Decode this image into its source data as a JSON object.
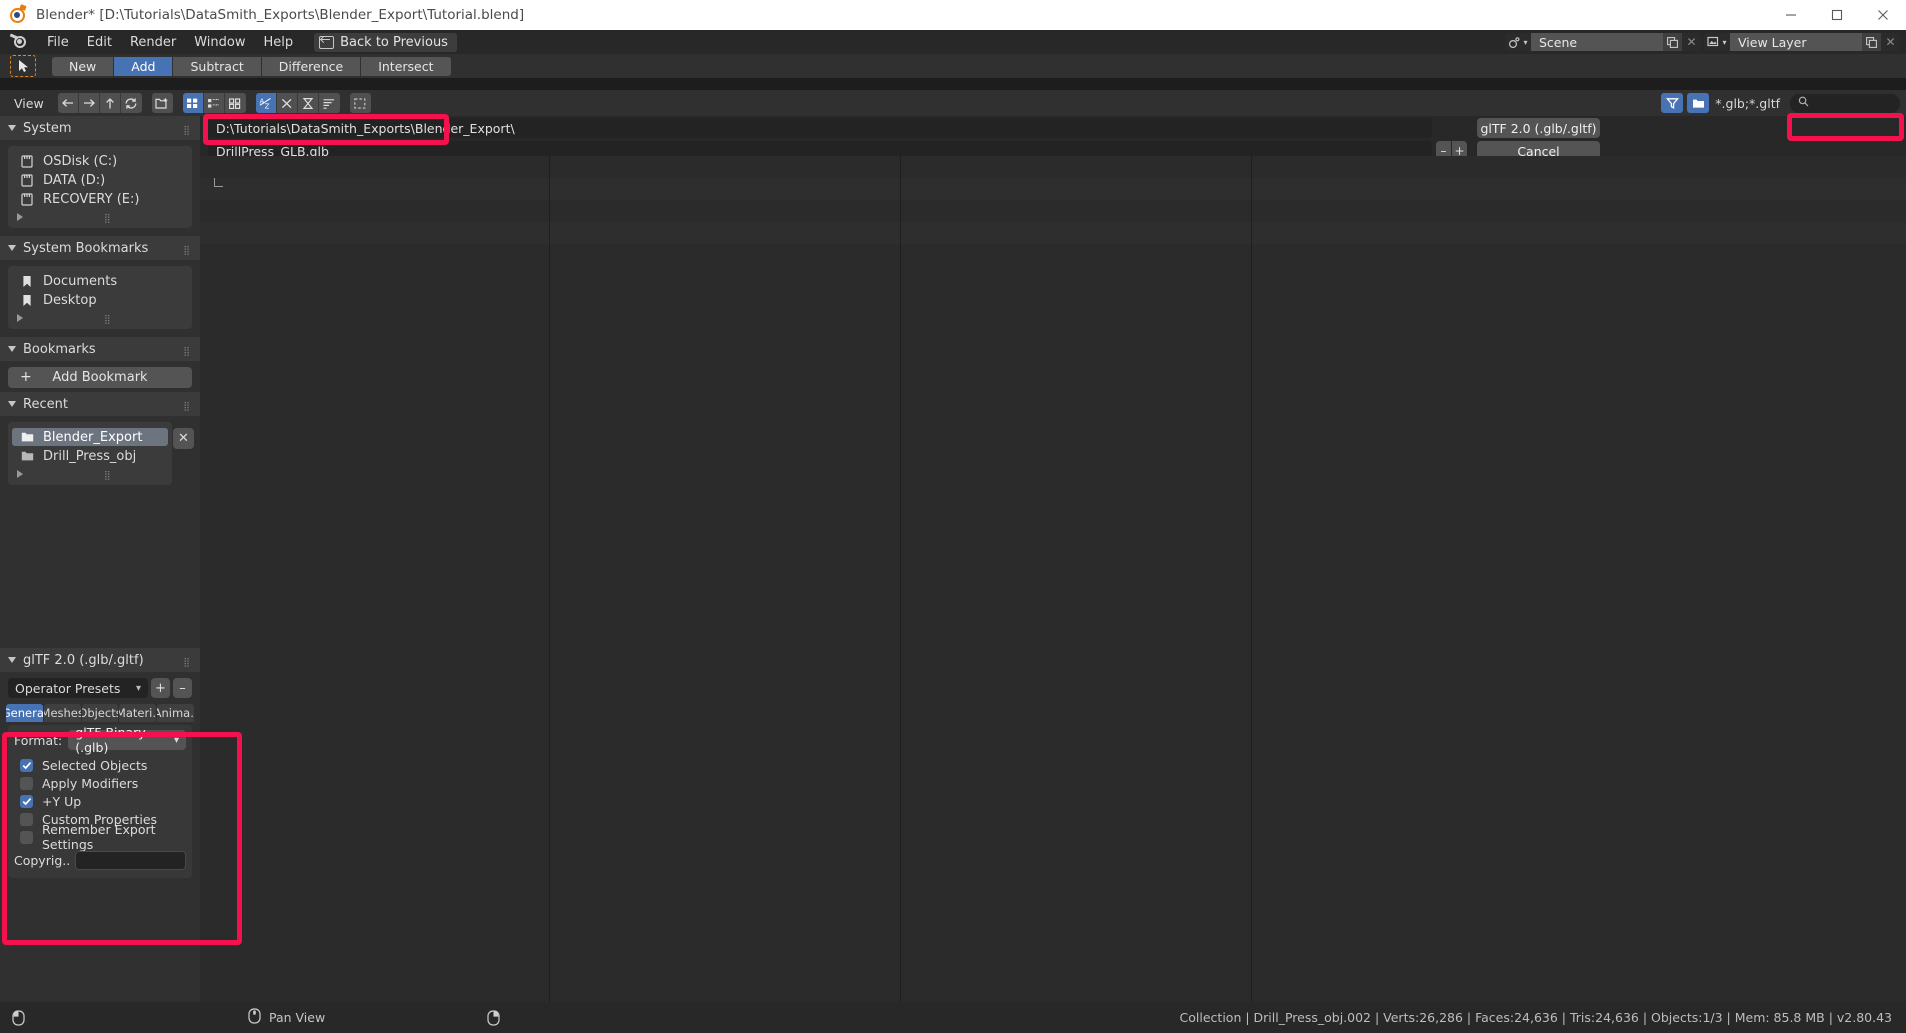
{
  "window": {
    "title": "Blender* [D:\\Tutorials\\DataSmith_Exports\\Blender_Export\\Tutorial.blend]",
    "minimize": "—",
    "maximize": "□",
    "close": "✕"
  },
  "topbar": {
    "menus": [
      "File",
      "Edit",
      "Render",
      "Window",
      "Help"
    ],
    "back_to_previous": "Back to Previous",
    "scene_value": "Scene",
    "view_layer_value": "View Layer"
  },
  "toolrow": {
    "modes": [
      "New",
      "Add",
      "Subtract",
      "Difference",
      "Intersect"
    ],
    "active_mode": "Add"
  },
  "filebrowser": {
    "view_label": "View",
    "filter_ext": "*.glb;*.gltf",
    "search_placeholder": "",
    "path_value": "D:\\Tutorials\\DataSmith_Exports\\Blender_Export\\",
    "filename_value": "DrillPress_GLB.glb",
    "decrement": "–",
    "increment": "+",
    "execute_label": "glTF 2.0 (.glb/.gltf)",
    "cancel_label": "Cancel"
  },
  "sidebar": {
    "system": {
      "title": "System",
      "items": [
        {
          "label": "OSDisk (C:)",
          "icon": "drive-icon"
        },
        {
          "label": "DATA (D:)",
          "icon": "drive-icon"
        },
        {
          "label": "RECOVERY (E:)",
          "icon": "drive-icon"
        }
      ]
    },
    "system_bookmarks": {
      "title": "System Bookmarks",
      "items": [
        {
          "label": "Documents",
          "icon": "bookmark-icon"
        },
        {
          "label": "Desktop",
          "icon": "bookmark-icon"
        }
      ]
    },
    "bookmarks": {
      "title": "Bookmarks",
      "add_label": "Add Bookmark"
    },
    "recent": {
      "title": "Recent",
      "items": [
        {
          "label": "Blender_Export",
          "icon": "folder-icon",
          "selected": true
        },
        {
          "label": "Drill_Press_obj",
          "icon": "folder-icon",
          "selected": false
        }
      ]
    }
  },
  "operator": {
    "title": "glTF 2.0 (.glb/.gltf)",
    "preset_label": "Operator Presets",
    "preset_add": "+",
    "preset_remove": "–",
    "tabs": [
      "General",
      "Meshes",
      "Objects",
      "Materi..",
      "Anima.."
    ],
    "active_tab": "General",
    "format_label": "Format:",
    "format_value": "glTF Binary (.glb)",
    "options": [
      {
        "label": "Selected Objects",
        "checked": true
      },
      {
        "label": "Apply Modifiers",
        "checked": false
      },
      {
        "label": "+Y Up",
        "checked": true
      },
      {
        "label": "Custom Properties",
        "checked": false
      },
      {
        "label": "Remember Export Settings",
        "checked": false
      }
    ],
    "copyright_label": "Copyrig..",
    "copyright_value": ""
  },
  "statusbar": {
    "pan_view": "Pan View",
    "info": "Collection | Drill_Press_obj.002 | Verts:26,286 | Faces:24,636 | Tris:24,636 | Objects:1/3 | Mem: 85.8 MB | v2.80.43"
  },
  "colors": {
    "accent_blue": "#4772b3",
    "annotation_red": "#f5114e",
    "panel_bg": "#303030",
    "field_bg": "#232323"
  }
}
